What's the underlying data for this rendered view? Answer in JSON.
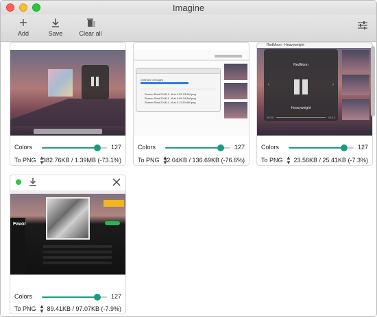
{
  "window": {
    "title": "Imagine"
  },
  "toolbar": {
    "add_label": "Add",
    "save_label": "Save",
    "clear_label": "Clear all"
  },
  "colors": {
    "accent": "#1a9b86",
    "done_dot": "#28c840",
    "progress": "#2f7ae5"
  },
  "cards": [
    {
      "colors_label": "Colors",
      "colors_value": "127",
      "colors_fraction": 0.85,
      "format": "To PNG",
      "sizes": "382.76KB / 1.39MB (-73.1%)"
    },
    {
      "dialog_title": "Optimize 3 images",
      "colors_label": "Colors",
      "colors_value": "127",
      "colors_fraction": 0.85,
      "format": "To PNG",
      "sizes": "32.04KB / 136.69KB (-76.6%)",
      "file_rows": [
        "Screen Shot 2018-1...8 at 4.02.23 AM.png",
        "Screen Shot 2018-1...8 at 4.09.24 AM.png",
        "Screen Shot 2018-1...8 at 4.11.20 AM.png"
      ]
    },
    {
      "now_playing": "RedMoon - Heavyweight",
      "track_title": "RedMoon",
      "artist": "Heavyweight",
      "time_elapsed": "00:20",
      "time_total": "03:12",
      "colors_label": "Colors",
      "colors_value": "127",
      "colors_fraction": 0.85,
      "format": "To PNG",
      "sizes": "23.56KB / 25.41KB (-7.3%)"
    },
    {
      "playlist_title": "Favor",
      "colors_label": "Colors",
      "colors_value": "127",
      "colors_fraction": 0.85,
      "format": "To PNG",
      "sizes": "89.41KB / 97.07KB (-7.9%)"
    }
  ]
}
